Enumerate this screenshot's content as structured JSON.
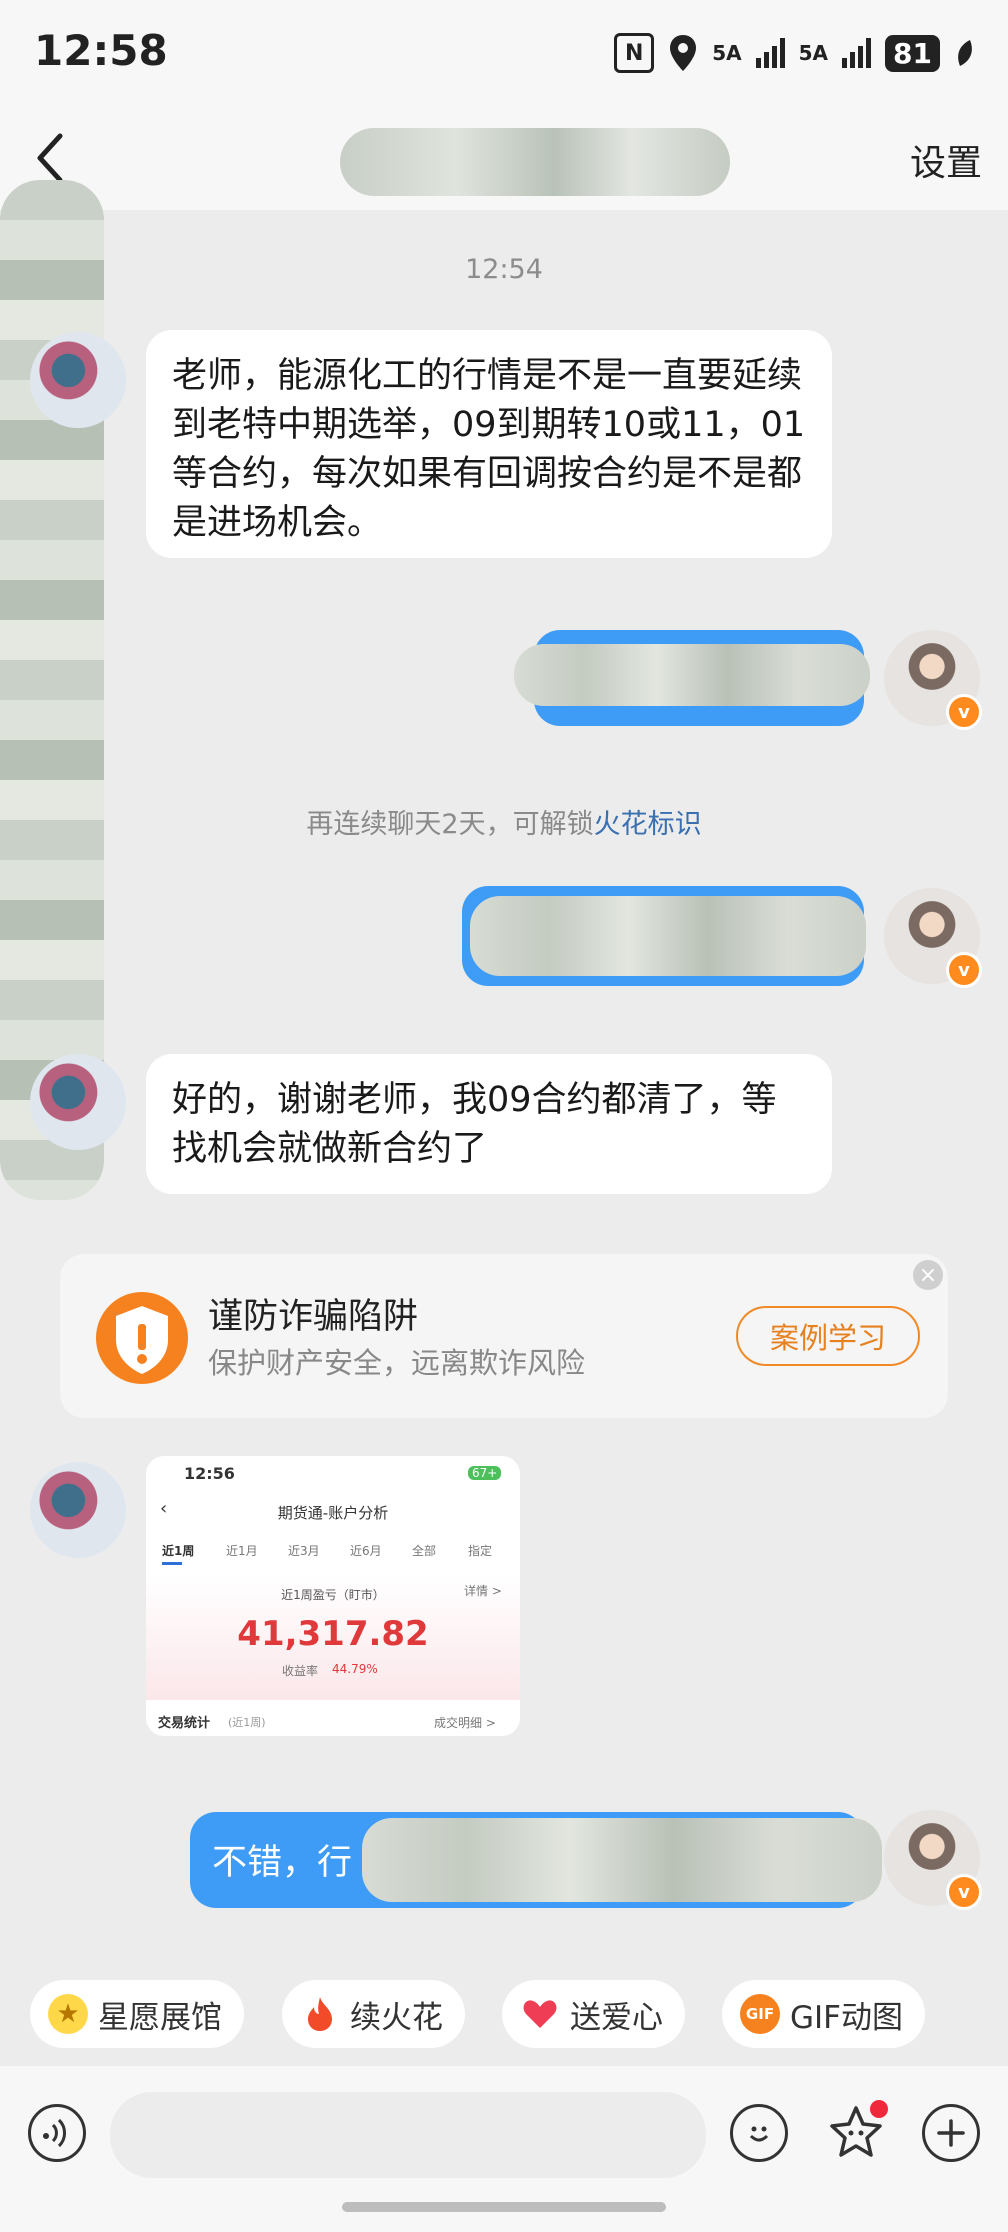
{
  "status_bar": {
    "time": "12:58",
    "network1": "5A",
    "network2": "5A",
    "battery": "81",
    "nfc": "N"
  },
  "header": {
    "back_icon": "chevron-left-icon",
    "settings_label": "设置"
  },
  "chat": {
    "timestamp": "12:54",
    "incoming_1": "老师，能源化工的行情是不是一直要延续到老特中期选举，09到期转10或11，01等合约，每次如果有回调按合约是不是都是进场机会。",
    "system_tip_text": "再连续聊天2天，可解锁",
    "system_tip_link": "火花标识",
    "incoming_2": "好的，谢谢老师，我09合约都清了，等找机会就做新合约了",
    "outgoing_last_visible": "不错，行"
  },
  "fraud_card": {
    "title": "谨防诈骗陷阱",
    "subtitle": "保护财产安全，远离欺诈风险",
    "button": "案例学习",
    "accent": "#f5821f"
  },
  "image_message": {
    "time": "12:56",
    "battery": "67+",
    "title": "期货通-账户分析",
    "tabs": [
      "近1周",
      "近1月",
      "近3月",
      "近6月",
      "全部",
      "指定"
    ],
    "detail_link": "详情 >",
    "pnl_label": "近1周盈亏（盯市）",
    "pnl_value": "41,317.82",
    "yield_label": "收益率",
    "yield_value": "44.79%",
    "stats_label": "交易统计",
    "stats_period": "(近1周)",
    "detail_trades": "成交明细 >"
  },
  "quick_actions": [
    {
      "label": "星愿展馆",
      "icon": "star-icon"
    },
    {
      "label": "续火花",
      "icon": "fire-icon"
    },
    {
      "label": "送爱心",
      "icon": "heart-icon"
    },
    {
      "label": "GIF动图",
      "icon": "gif-icon",
      "badge": "GIF"
    }
  ],
  "colors": {
    "bubble_out": "#3f9cf6",
    "link": "#3a6fb0",
    "background": "#ececec"
  }
}
